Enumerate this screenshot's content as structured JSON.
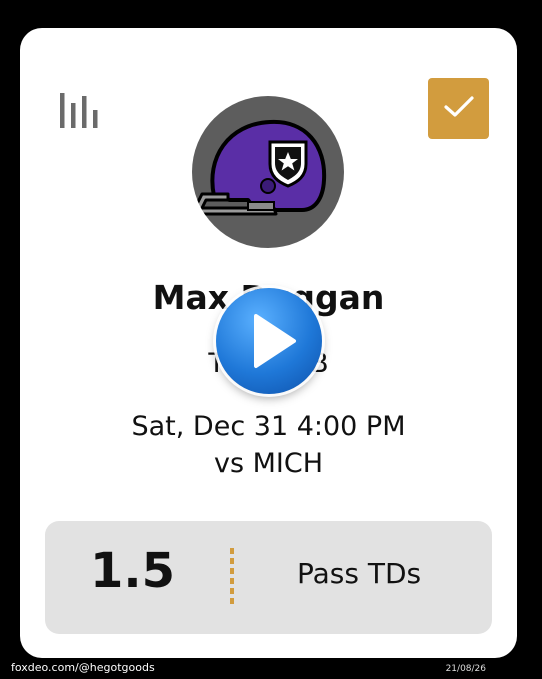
{
  "card": {
    "player_name": "Max Duggan",
    "team_position": "TCU - QB",
    "game_time": "Sat, Dec 31 4:00 PM",
    "opponent": "vs MICH",
    "prop_line": "1.5",
    "prop_stat": "Pass TDs",
    "icons": {
      "stats": "bar-chart-icon",
      "select": "check-icon",
      "avatar": "football-helmet-icon",
      "overlay": "play-icon"
    },
    "colors": {
      "accent": "#d29c3e",
      "helmet": "#5a2ea6",
      "avatar_bg": "#5d5d5d",
      "prop_bg": "#e2e2e2",
      "play_button": "#1f78d8"
    }
  },
  "watermark": {
    "left": "foxdeo.com/@hegotgoods",
    "right": "21/08/26"
  }
}
